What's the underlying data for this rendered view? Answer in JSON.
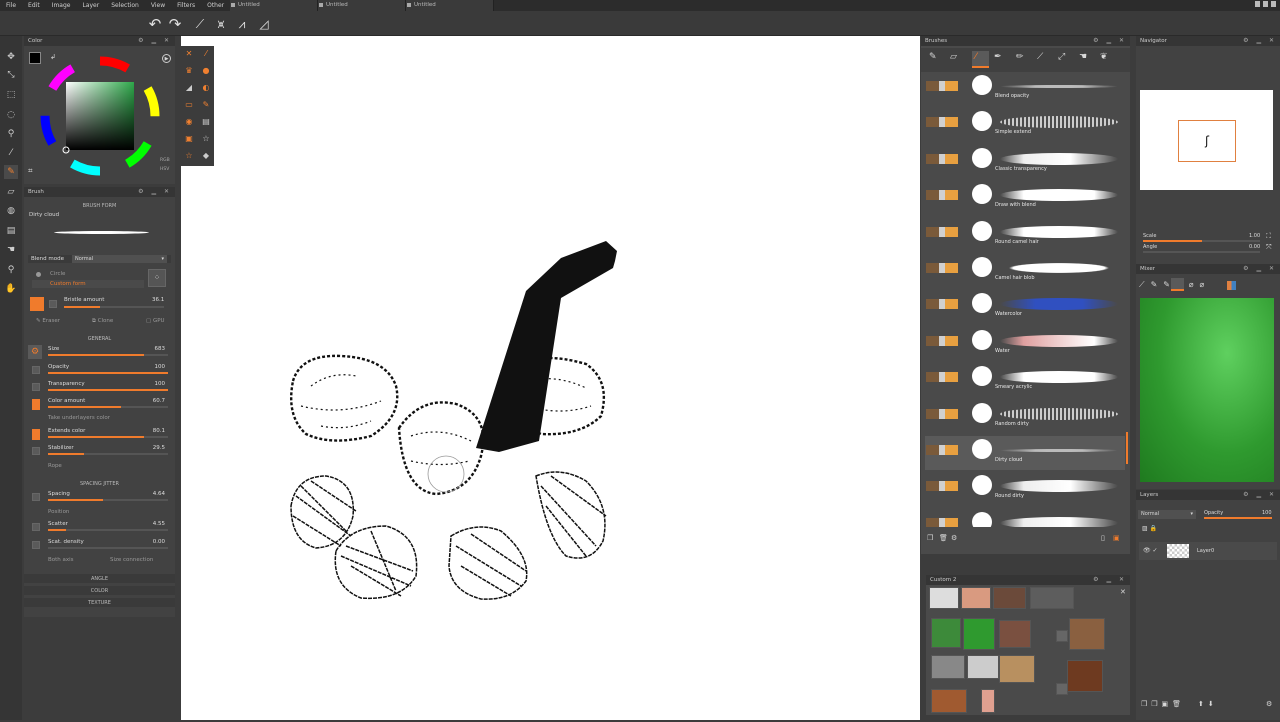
{
  "menu": [
    "File",
    "Edit",
    "Image",
    "Layer",
    "Selection",
    "View",
    "Filters",
    "Other"
  ],
  "doc_tabs": [
    "Untitled",
    "Untitled",
    "Untitled"
  ],
  "color_panel": {
    "title": "Color",
    "models": [
      "RGB",
      "HSV"
    ]
  },
  "brush_panel": {
    "title": "Brush",
    "form_header": "BRUSH FORM",
    "form_name": "Dirty cloud",
    "blend_mode_label": "Blend mode",
    "blend_mode_value": "Normal",
    "shape_options": [
      "Circle",
      "Custom form"
    ],
    "bristle": {
      "label": "Bristle amount",
      "value": "36.1"
    },
    "modes": [
      "Eraser",
      "Clone",
      "GPU"
    ],
    "general_header": "GENERAL",
    "sliders": [
      {
        "label": "Size",
        "value": "683",
        "pct": 80
      },
      {
        "label": "Opacity",
        "value": "100",
        "pct": 100
      },
      {
        "label": "Transparency",
        "value": "100",
        "pct": 100
      },
      {
        "label": "Color amount",
        "value": "60.7",
        "pct": 61
      }
    ],
    "take_under": "Take underlayers color",
    "sliders2": [
      {
        "label": "Extends color",
        "value": "80.1",
        "pct": 80
      },
      {
        "label": "Stabilizer",
        "value": "29.5",
        "pct": 30
      }
    ],
    "rope": "Rope",
    "jitter_header": "SPACING JITTER",
    "jitter": [
      {
        "label": "Spacing",
        "value": "4.64",
        "pct": 46
      },
      {
        "label": "Position",
        "value": "",
        "pct": 0
      },
      {
        "label": "Scatter",
        "value": "4.55",
        "pct": 15
      },
      {
        "label": "Scat. density",
        "value": "0.00",
        "pct": 0
      }
    ],
    "both_axis": "Both axis",
    "size_connection": "Size connection",
    "collapsed": [
      "ANGLE",
      "COLOR",
      "TEXTURE"
    ]
  },
  "brushes_panel": {
    "title": "Brushes",
    "items": [
      {
        "name": "Blend opacity",
        "stroke": "thin"
      },
      {
        "name": "Simple extend",
        "stroke": "dotted"
      },
      {
        "name": "Classic transparency",
        "stroke": "soft"
      },
      {
        "name": "Draw with blend",
        "stroke": "solid"
      },
      {
        "name": "Round camel hair",
        "stroke": "solid"
      },
      {
        "name": "Camel hair blob",
        "stroke": "blob"
      },
      {
        "name": "Watercolor",
        "stroke": "blue"
      },
      {
        "name": "Water",
        "stroke": "pink"
      },
      {
        "name": "Smeary acrylic",
        "stroke": "solid"
      },
      {
        "name": "Random dirty",
        "stroke": "dotted"
      },
      {
        "name": "Dirty cloud",
        "stroke": "thin",
        "selected": true
      },
      {
        "name": "Round dirty",
        "stroke": "soft"
      },
      {
        "name": "",
        "stroke": "soft"
      }
    ]
  },
  "custom_panel": {
    "title": "Custom 2"
  },
  "navigator": {
    "title": "Navigator",
    "scale_label": "Scale",
    "scale_value": "1.00",
    "angle_label": "Angle",
    "angle_value": "0.00",
    "preview_glyph": "ʃ"
  },
  "mixer": {
    "title": "Mixer"
  },
  "layers": {
    "title": "Layers",
    "blend": "Normal",
    "opacity_label": "Opacity",
    "opacity_value": "100",
    "layer_name": "Layer0"
  },
  "colors": {
    "accent": "#f07b2c",
    "canvas": "#ffffff",
    "panel": "#424242",
    "mixer_green": "#2f9a2f"
  }
}
